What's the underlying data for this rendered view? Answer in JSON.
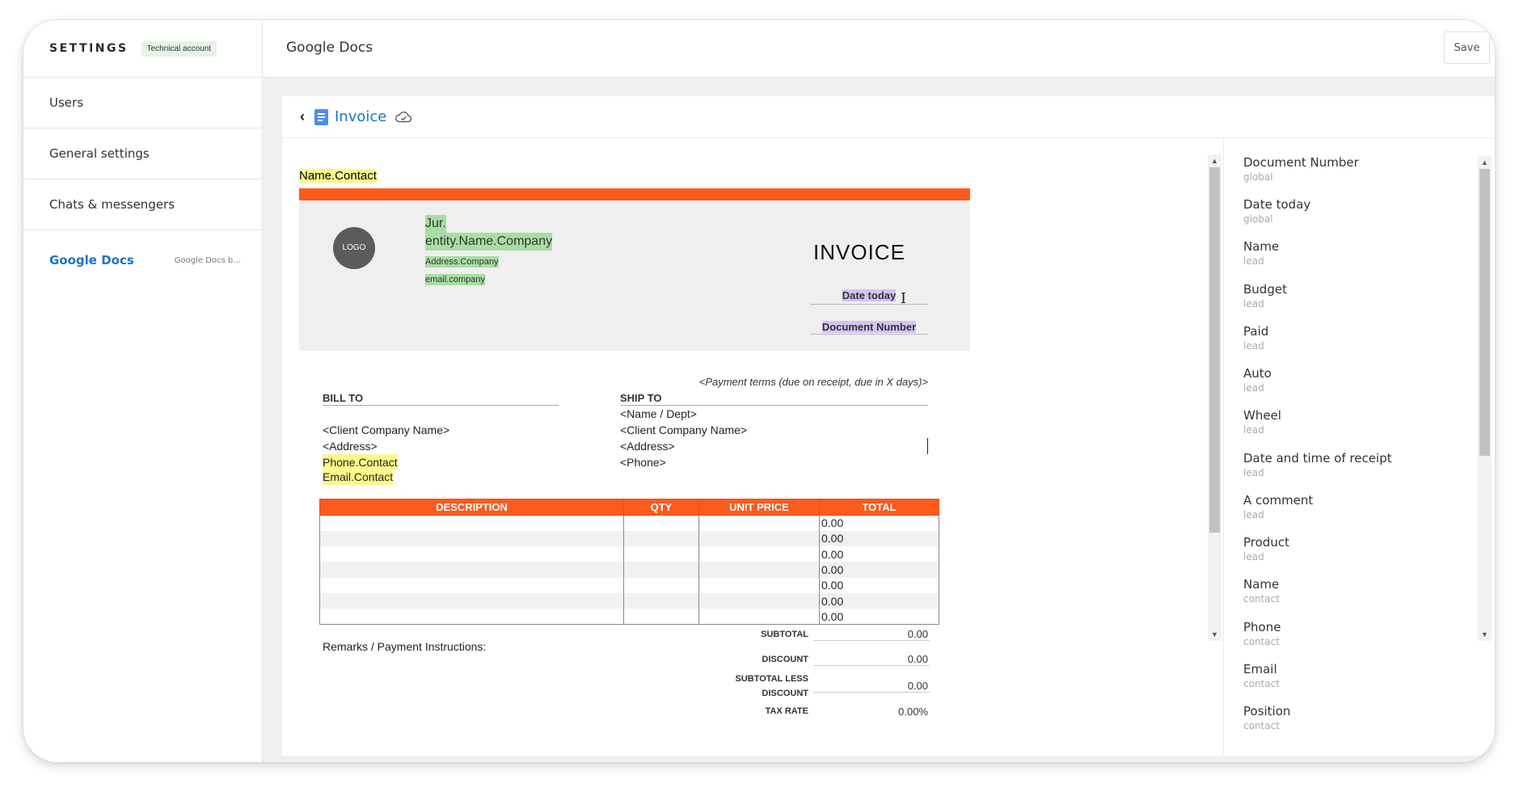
{
  "sidebar": {
    "title": "SETTINGS",
    "badge": "Technical account",
    "items": [
      {
        "label": "Users"
      },
      {
        "label": "General settings"
      },
      {
        "label": "Chats & messengers"
      },
      {
        "label": "Google Docs",
        "sub": "Google Docs b..."
      }
    ]
  },
  "header": {
    "title": "Google Docs",
    "save_label": "Save"
  },
  "doc": {
    "back": "‹",
    "title": "Invoice"
  },
  "invoice": {
    "contact_name": "Name.Contact",
    "logo": "LOGO",
    "company_jur": "Jur.",
    "company_name": "entity.Name.Company",
    "company_address": "Address.Company",
    "company_email": "email.company",
    "title": "INVOICE",
    "date": "Date today",
    "doc_number": "Document Number",
    "payment_terms": "<Payment terms (due on receipt, due in X days)>",
    "bill_to": {
      "heading": "BILL TO",
      "company": "<Client Company Name>",
      "address": "<Address>",
      "phone": "Phone.Contact",
      "email": "Email.Contact"
    },
    "ship_to": {
      "heading": "SHIP TO",
      "name": "<Name / Dept>",
      "company": "<Client Company Name>",
      "address": "<Address>",
      "phone": "<Phone>"
    },
    "table": {
      "headers": [
        "DESCRIPTION",
        "QTY",
        "UNIT PRICE",
        "TOTAL"
      ],
      "totals": [
        "0.00",
        "0.00",
        "0.00",
        "0.00",
        "0.00",
        "0.00",
        "0.00"
      ]
    },
    "remarks": "Remarks / Payment Instructions:",
    "summary": {
      "subtotal_label": "SUBTOTAL",
      "subtotal": "0.00",
      "discount_label": "DISCOUNT",
      "discount": "0.00",
      "sld_label_1": "SUBTOTAL LESS",
      "sld_label_2": "DISCOUNT",
      "sld": "0.00",
      "tax_label": "TAX RATE",
      "tax": "0.00%"
    }
  },
  "fields": [
    {
      "name": "Document Number",
      "scope": "global"
    },
    {
      "name": "Date today",
      "scope": "global"
    },
    {
      "name": "Name",
      "scope": "lead"
    },
    {
      "name": "Budget",
      "scope": "lead"
    },
    {
      "name": "Paid",
      "scope": "lead"
    },
    {
      "name": "Auto",
      "scope": "lead"
    },
    {
      "name": "Wheel",
      "scope": "lead"
    },
    {
      "name": "Date and time of receipt",
      "scope": "lead"
    },
    {
      "name": "A comment",
      "scope": "lead"
    },
    {
      "name": "Product",
      "scope": "lead"
    },
    {
      "name": "Name",
      "scope": "contact"
    },
    {
      "name": "Phone",
      "scope": "contact"
    },
    {
      "name": "Email",
      "scope": "contact"
    },
    {
      "name": "Position",
      "scope": "contact"
    }
  ],
  "colors": {
    "accent": "#1a73c7",
    "invoice_orange": "#fd5a1e",
    "highlight_yellow": "#fdf98b",
    "highlight_green": "#a8dea4",
    "highlight_purple": "#d4c3f5"
  }
}
